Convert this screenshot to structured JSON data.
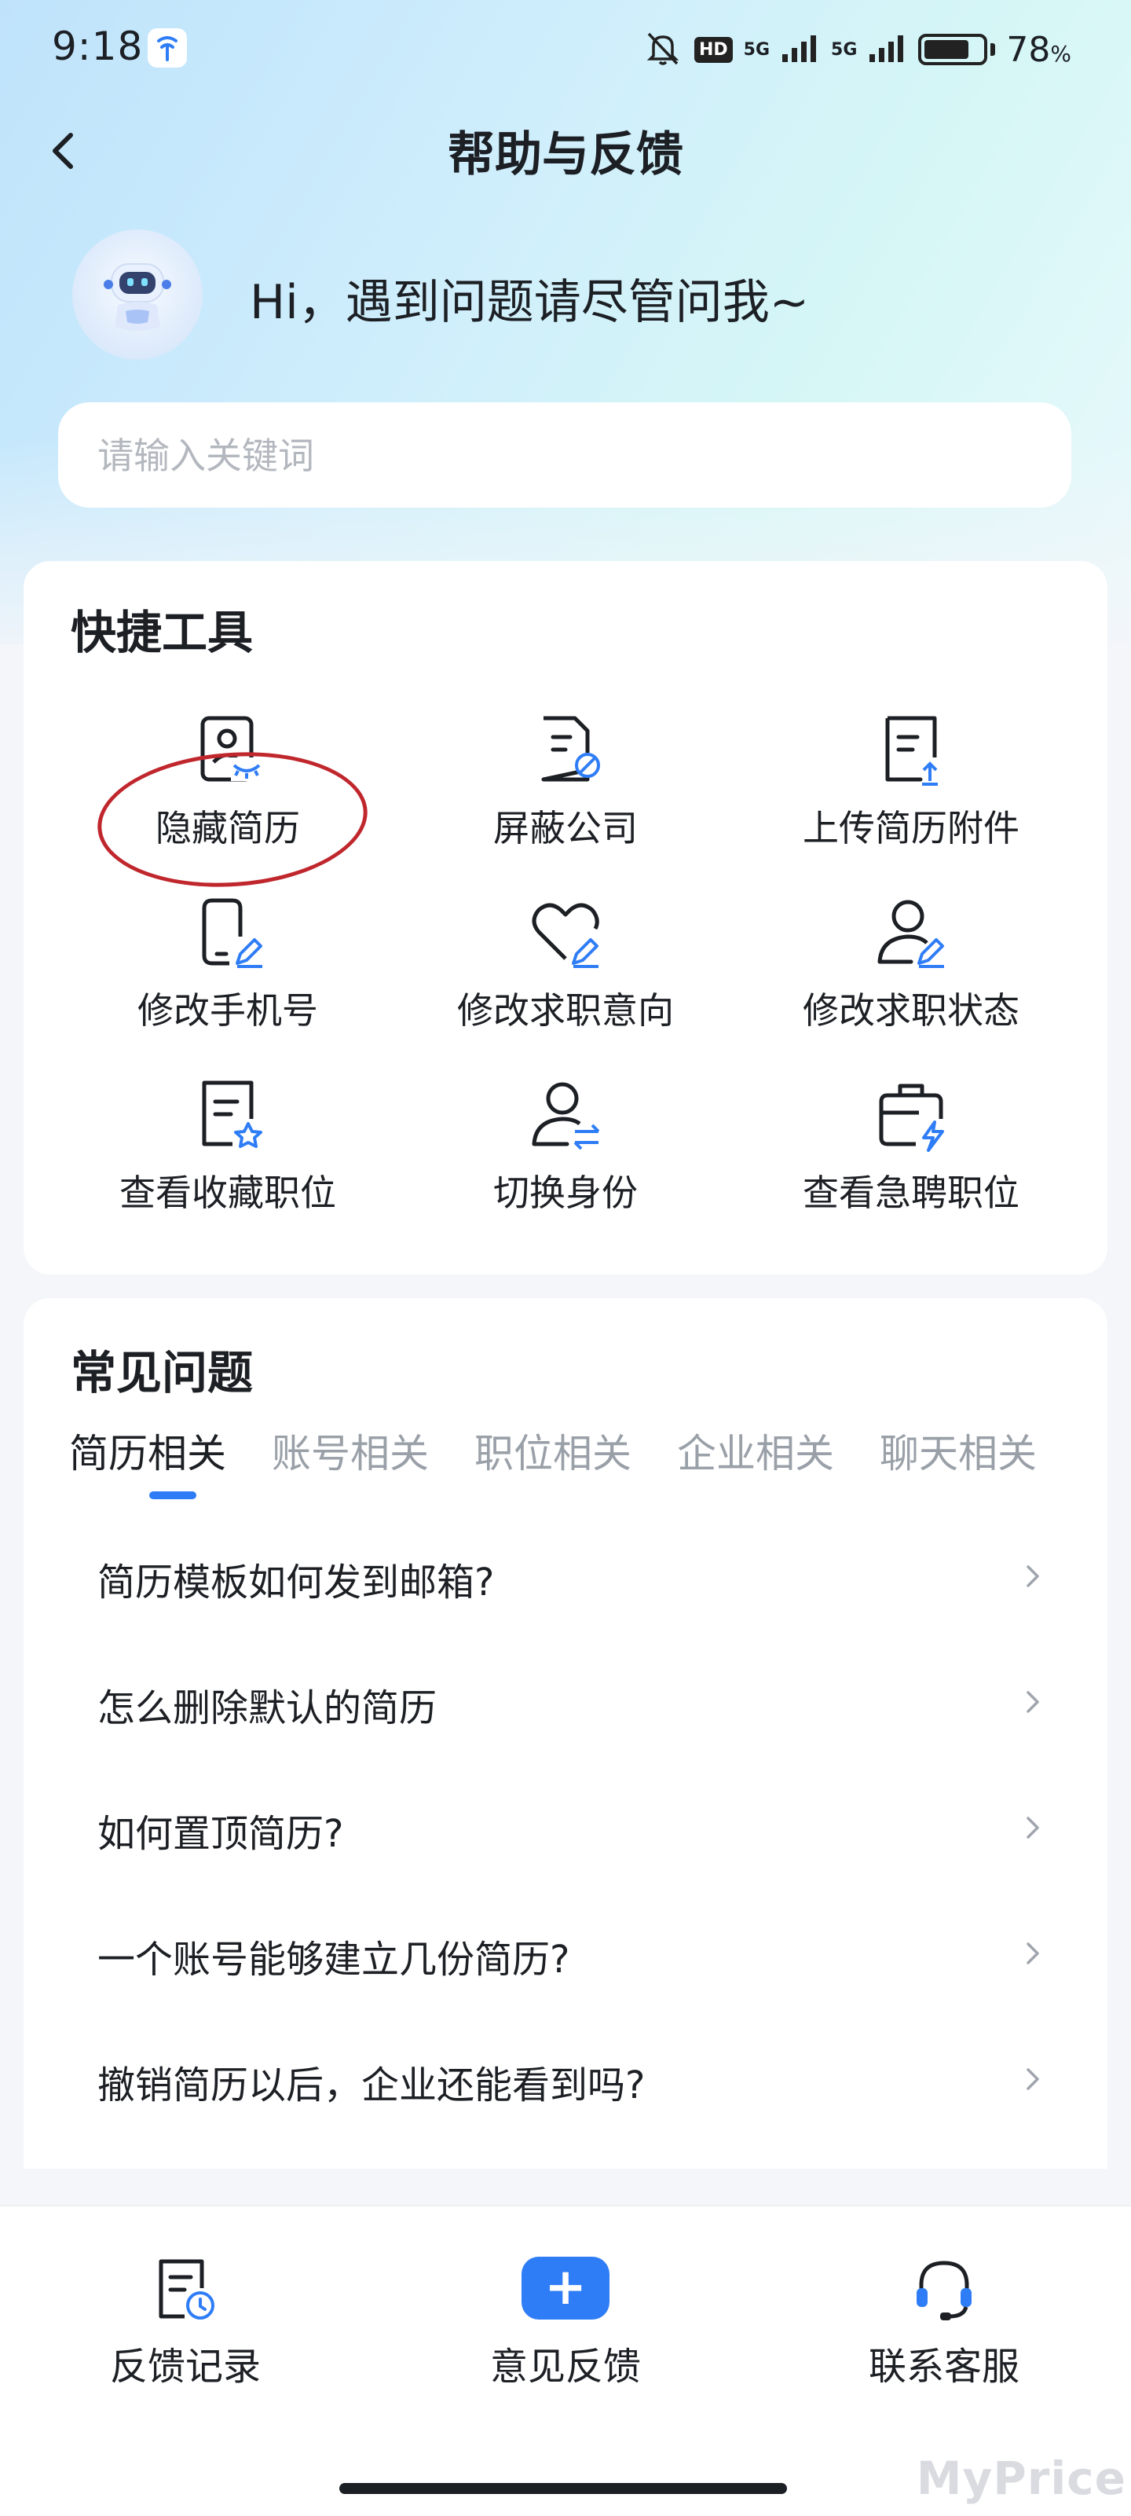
{
  "status_bar": {
    "time": "9:18",
    "hd_label": "HD",
    "network_1": "5G",
    "network_2": "5G",
    "battery_percent_value": "78",
    "battery_percent_unit": "%",
    "battery_level": 0.78
  },
  "header": {
    "title": "帮助与反馈"
  },
  "greeting": {
    "text": "Hi，遇到问题请尽管问我~"
  },
  "search": {
    "placeholder": "请输入关键词"
  },
  "tools": {
    "title": "快捷工具",
    "items": [
      {
        "label": "隐藏简历",
        "icon": "hide-resume-icon"
      },
      {
        "label": "屏蔽公司",
        "icon": "block-company-icon"
      },
      {
        "label": "上传简历附件",
        "icon": "upload-attachment-icon"
      },
      {
        "label": "修改手机号",
        "icon": "edit-phone-icon"
      },
      {
        "label": "修改求职意向",
        "icon": "edit-intention-icon"
      },
      {
        "label": "修改求职状态",
        "icon": "edit-status-icon"
      },
      {
        "label": "查看收藏职位",
        "icon": "favorite-jobs-icon"
      },
      {
        "label": "切换身份",
        "icon": "switch-identity-icon"
      },
      {
        "label": "查看急聘职位",
        "icon": "urgent-jobs-icon"
      }
    ]
  },
  "faq": {
    "title": "常见问题",
    "tabs": [
      "简历相关",
      "账号相关",
      "职位相关",
      "企业相关",
      "聊天相关"
    ],
    "active_tab": "简历相关",
    "questions": [
      "简历模板如何发到邮箱?",
      "怎么删除默认的简历",
      "如何置顶简历?",
      "一个账号能够建立几份简历?",
      "撤销简历以后，企业还能看到吗?"
    ]
  },
  "bottom_bar": {
    "items": [
      {
        "label": "反馈记录",
        "icon": "feedback-record-icon"
      },
      {
        "label": "意见反馈",
        "icon": "plus-icon",
        "symbol": "+"
      },
      {
        "label": "联系客服",
        "icon": "headset-icon"
      }
    ]
  },
  "watermark": "MyPrice",
  "colors": {
    "accent": "#2f7df6",
    "annotation_circle": "#c0272d",
    "text": "#1c1f24",
    "muted": "#9aa0a8"
  }
}
